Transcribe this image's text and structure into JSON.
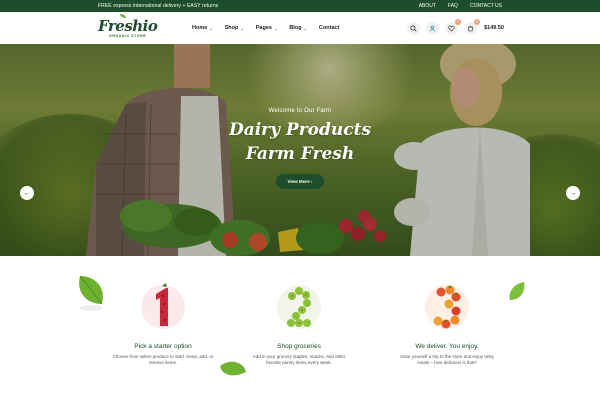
{
  "topbar": {
    "message": "FREE express international delivery + EASY returns",
    "links": [
      "ABOUT",
      "FAQ",
      "CONTACT US"
    ]
  },
  "header": {
    "logo": {
      "brand": "Freshio",
      "tagline": "ORGANIC STORE"
    },
    "nav": [
      {
        "label": "Home",
        "has_dropdown": true
      },
      {
        "label": "Shop",
        "has_dropdown": true
      },
      {
        "label": "Pages",
        "has_dropdown": true
      },
      {
        "label": "Blog",
        "has_dropdown": true
      },
      {
        "label": "Contact",
        "has_dropdown": false
      }
    ],
    "wishlist_count": "0",
    "cart_count": "0",
    "cart_total": "$149.50",
    "icons": [
      "search-icon",
      "user-icon",
      "heart-icon",
      "cart-icon"
    ]
  },
  "hero": {
    "kicker": "Welcome to Our Farm",
    "title_line1": "Dairy Products",
    "title_line2": "Farm Fresh",
    "button": "View More"
  },
  "steps": [
    {
      "number": "1",
      "title": "Pick a starter option",
      "description": "Choose from select produce to start. Keep, add, or remove items."
    },
    {
      "number": "2",
      "title": "Shop groceries",
      "description": "Add in your grocery staples, snacks, and other favorite pantry items every week."
    },
    {
      "number": "3",
      "title": "We deliver. You enjoy.",
      "description": "Save yourself a trip to the store and enjoy tasty meals – how delicious is that?"
    }
  ],
  "colors": {
    "brand_green": "#1e4d2b",
    "badge": "#e5a37a",
    "leaf": "#7bbf3a"
  }
}
